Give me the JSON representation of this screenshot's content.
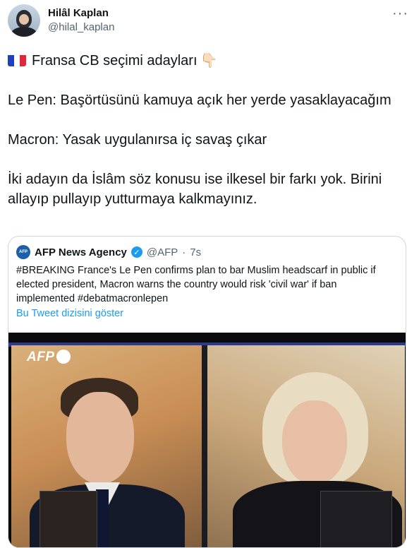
{
  "author": {
    "name": "Hilâl Kaplan",
    "handle": "@hilal_kaplan"
  },
  "more_label": "···",
  "tweet": {
    "line1": "Fransa CB seçimi adayları",
    "line1_flag": "france-flag",
    "line1_emoji": "👇🏻",
    "line2": "Le Pen: Başörtüsünü kamuya açık her yerde yasaklayacağım",
    "line3": "Macron: Yasak uygulanırsa iç savaş çıkar",
    "line4": "İki adayın da İslâm söz konusu ise ilkesel bir farkı yok. Birini allayıp pullayıp yutturmaya kalkmayınız."
  },
  "quote": {
    "logo_text": "AFP",
    "name": "AFP News Agency",
    "verified_icon": "verified-badge-icon",
    "handle": "@AFP",
    "separator": "·",
    "time": "7s",
    "text": "#BREAKING France's Le Pen confirms plan to bar Muslim headscarf in public if elected president, Macron warns the country would risk 'civil war' if ban implemented #debatmacronlepen",
    "thread_link": "Bu Tweet dizisini göster",
    "image_badge": "AFP"
  },
  "colors": {
    "link": "#1d9bf0",
    "muted": "#536471",
    "text": "#0f1419",
    "border": "#cfd9de"
  }
}
